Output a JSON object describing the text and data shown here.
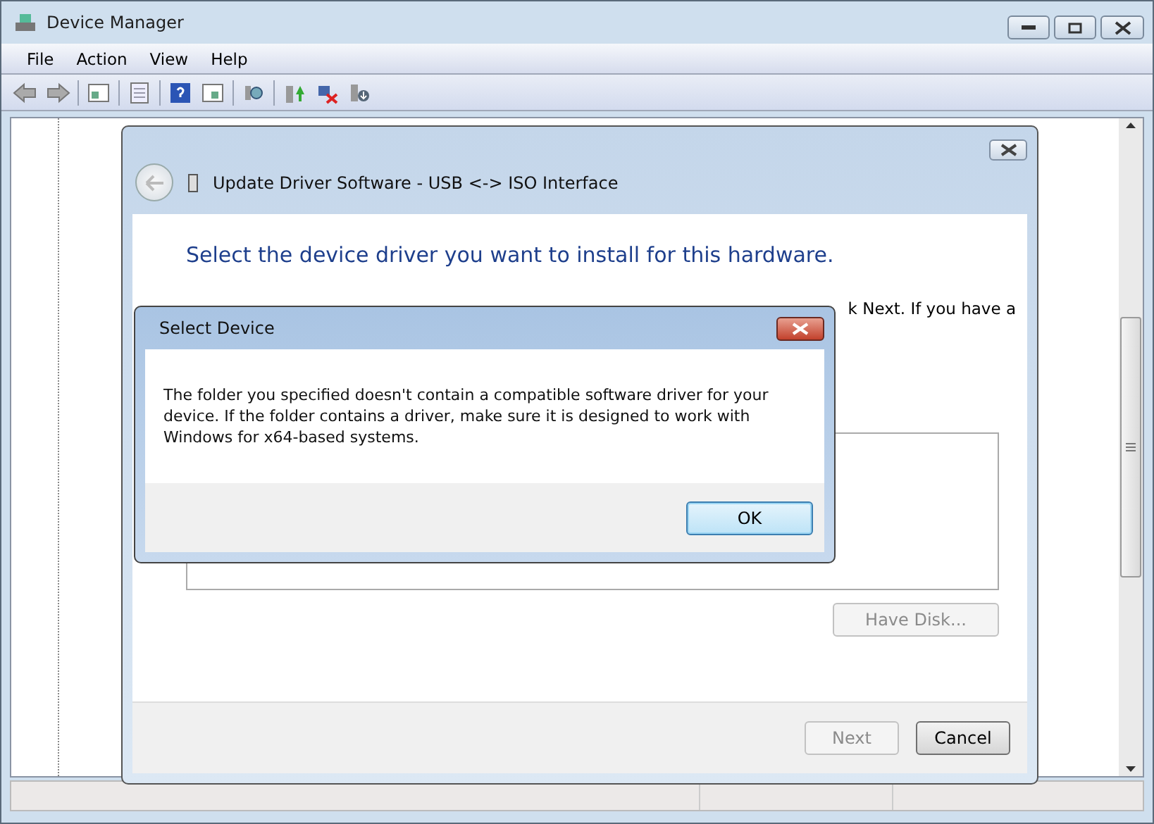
{
  "window": {
    "title": "Device Manager"
  },
  "menu": [
    "File",
    "Action",
    "View",
    "Help"
  ],
  "wizard": {
    "title": "Update Driver Software - USB <-> ISO Interface",
    "heading": "Select the device driver you want to install for this hardware.",
    "instruction": "k Next. If you have a",
    "have_disk": {
      "label": "Have Disk...",
      "disabled": true
    },
    "buttons": [
      {
        "label": "Next",
        "disabled": true
      },
      {
        "label": "Cancel",
        "disabled": false
      }
    ]
  },
  "alert": {
    "title": "Select Device",
    "message": "The folder you specified doesn't contain a compatible software driver for your device. If the folder contains a driver, make sure it is designed to work with Windows for x64-based systems.",
    "button": "OK"
  }
}
